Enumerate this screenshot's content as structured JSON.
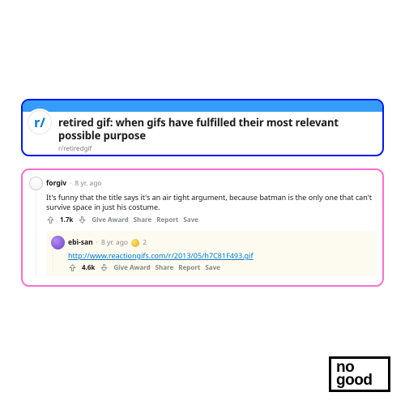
{
  "header": {
    "icon_glyph": "r/",
    "title": "retired gif: when gifs have fulfilled their most relevant possible purpose",
    "sub_link": "r/retiredgif"
  },
  "comment": {
    "author": "forgiv",
    "age": "8 yr. ago",
    "body": "It's funny that the title says it's an air tight argument, because batman is the only one that can't survive space in just his costume.",
    "score": "1.7k",
    "actions": {
      "award": "Give Award",
      "share": "Share",
      "report": "Report",
      "save": "Save"
    }
  },
  "reply": {
    "author": "ebi-san",
    "age": "8 yr. ago",
    "gold_count": "2",
    "link": "http://www.reactiongifs.com/r/2013/05/h7C81F493.gif",
    "score": "4.6k",
    "actions": {
      "award": "Give Award",
      "share": "Share",
      "report": "Report",
      "save": "Save"
    }
  },
  "logo": {
    "line1": "no",
    "line2": "good"
  }
}
